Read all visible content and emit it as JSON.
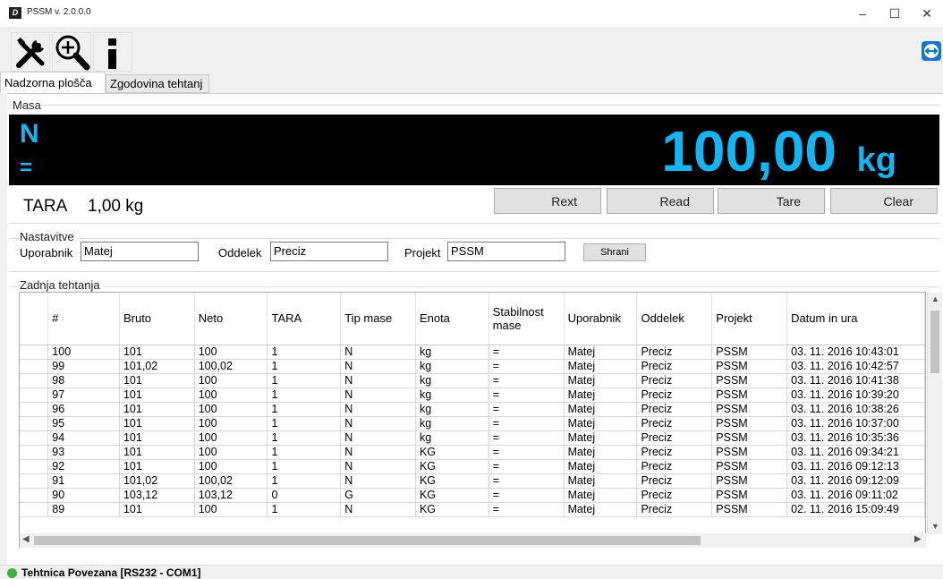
{
  "window": {
    "title": "PSSM v. 2.0.0.0",
    "app_icon_letter": "D"
  },
  "tabs": [
    {
      "label": "Nadzorna plošča"
    },
    {
      "label": "Zgodovina tehtanj"
    }
  ],
  "masa": {
    "group_label": "Masa",
    "mode": "N",
    "stability": "=",
    "value": "100,00",
    "unit": "kg",
    "display_color": "#16b4f0"
  },
  "tara": {
    "label": "TARA",
    "value": "1,00 kg"
  },
  "actions": {
    "rext": "Rext",
    "read": "Read",
    "tare": "Tare",
    "clear": "Clear"
  },
  "settings": {
    "group_label": "Nastavitve",
    "user_label": "Uporabnik",
    "user_value": "Matej",
    "dept_label": "Oddelek",
    "dept_value": "Preciz",
    "project_label": "Projekt",
    "project_value": "PSSM",
    "save_label": "Shrani"
  },
  "history": {
    "group_label": "Zadnja tehtanja",
    "columns": [
      "#",
      "Bruto",
      "Neto",
      "TARA",
      "Tip mase",
      "Enota",
      "Stabilnost mase",
      "Uporabnik",
      "Oddelek",
      "Projekt",
      "Datum in ura"
    ],
    "rows": [
      [
        "100",
        "101",
        "100",
        "1",
        "N",
        "kg",
        "=",
        "Matej",
        "Preciz",
        "PSSM",
        "03. 11. 2016 10:43:01"
      ],
      [
        "99",
        "101,02",
        "100,02",
        "1",
        "N",
        "kg",
        "=",
        "Matej",
        "Preciz",
        "PSSM",
        "03. 11. 2016 10:42:57"
      ],
      [
        "98",
        "101",
        "100",
        "1",
        "N",
        "kg",
        "=",
        "Matej",
        "Preciz",
        "PSSM",
        "03. 11. 2016 10:41:38"
      ],
      [
        "97",
        "101",
        "100",
        "1",
        "N",
        "kg",
        "=",
        "Matej",
        "Preciz",
        "PSSM",
        "03. 11. 2016 10:39:20"
      ],
      [
        "96",
        "101",
        "100",
        "1",
        "N",
        "kg",
        "=",
        "Matej",
        "Preciz",
        "PSSM",
        "03. 11. 2016 10:38:26"
      ],
      [
        "95",
        "101",
        "100",
        "1",
        "N",
        "kg",
        "=",
        "Matej",
        "Preciz",
        "PSSM",
        "03. 11. 2016 10:37:00"
      ],
      [
        "94",
        "101",
        "100",
        "1",
        "N",
        "kg",
        "=",
        "Matej",
        "Preciz",
        "PSSM",
        "03. 11. 2016 10:35:36"
      ],
      [
        "93",
        "101",
        "100",
        "1",
        "N",
        "KG",
        "=",
        "Matej",
        "Preciz",
        "PSSM",
        "03. 11. 2016 09:34:21"
      ],
      [
        "92",
        "101",
        "100",
        "1",
        "N",
        "KG",
        "=",
        "Matej",
        "Preciz",
        "PSSM",
        "03. 11. 2016 09:12:13"
      ],
      [
        "91",
        "101,02",
        "100,02",
        "1",
        "N",
        "KG",
        "=",
        "Matej",
        "Preciz",
        "PSSM",
        "03. 11. 2016 09:12:09"
      ],
      [
        "90",
        "103,12",
        "103,12",
        "0",
        "G",
        "KG",
        "=",
        "Matej",
        "Preciz",
        "PSSM",
        "03. 11. 2016 09:11:02"
      ],
      [
        "89",
        "101",
        "100",
        "1",
        "N",
        "KG",
        "=",
        "Matej",
        "Preciz",
        "PSSM",
        "02. 11. 2016 15:09:49"
      ]
    ]
  },
  "status": {
    "text": "Tehtnica Povezana [RS232 - COM1]",
    "color": "#3cb043"
  }
}
